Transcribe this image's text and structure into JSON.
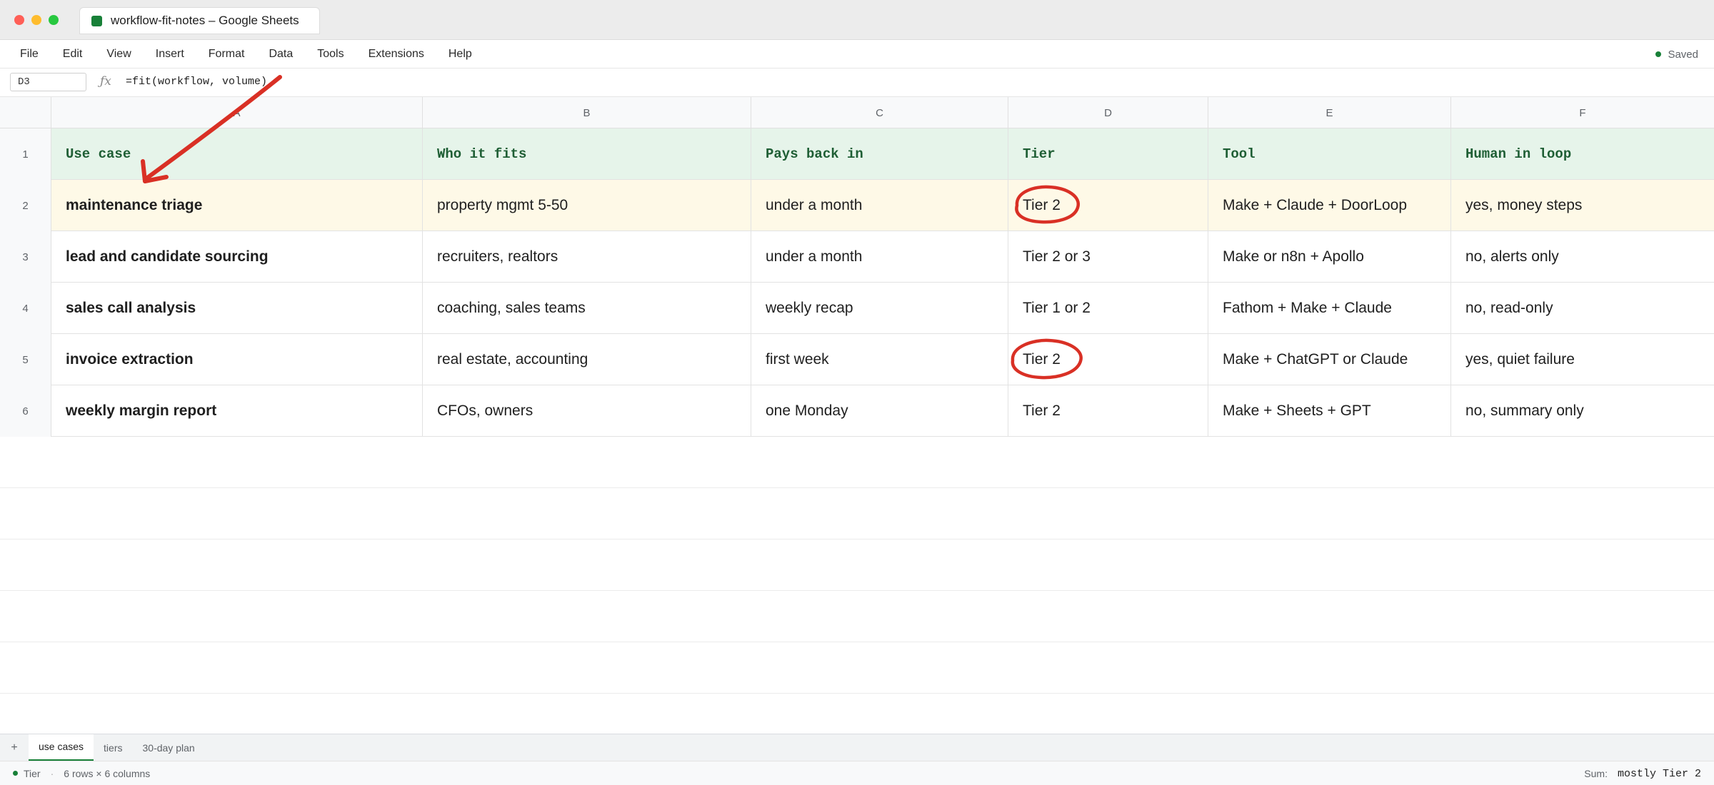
{
  "window": {
    "title": "workflow-fit-notes – Google Sheets"
  },
  "menu": [
    "File",
    "Edit",
    "View",
    "Insert",
    "Format",
    "Data",
    "Tools",
    "Extensions",
    "Help"
  ],
  "save_status": "Saved",
  "formula_bar": {
    "cell_ref": "D3",
    "fx": "ƒx",
    "formula": "=fit(workflow, volume)"
  },
  "columns": [
    "A",
    "B",
    "C",
    "D",
    "E",
    "F"
  ],
  "table": {
    "headers": [
      "Use case",
      "Who it fits",
      "Pays back in",
      "Tier",
      "Tool",
      "Human in loop"
    ],
    "rows": [
      [
        "maintenance triage",
        "property mgmt 5-50",
        "under a month",
        "Tier 2",
        "Make + Claude + DoorLoop",
        "yes, money steps"
      ],
      [
        "lead and candidate sourcing",
        "recruiters, realtors",
        "under a month",
        "Tier 2 or 3",
        "Make or n8n + Apollo",
        "no, alerts only"
      ],
      [
        "sales call analysis",
        "coaching, sales teams",
        "weekly recap",
        "Tier 1 or 2",
        "Fathom + Make + Claude",
        "no, read-only"
      ],
      [
        "invoice extraction",
        "real estate, accounting",
        "first week",
        "Tier 2",
        "Make + ChatGPT or Claude",
        "yes, quiet failure"
      ],
      [
        "weekly margin report",
        "CFOs, owners",
        "one Monday",
        "Tier 2",
        "Make + Sheets + GPT",
        "no, summary only"
      ]
    ]
  },
  "row_numbers": [
    "1",
    "2",
    "3",
    "4",
    "5",
    "6"
  ],
  "sheet_tabs": {
    "add": "+",
    "tabs": [
      "use cases",
      "tiers",
      "30-day plan"
    ]
  },
  "status": {
    "label": "Tier",
    "separator": "·",
    "dims": "6 rows × 6 columns",
    "sum_label": "Sum:",
    "sum_value": "mostly Tier 2"
  },
  "colors": {
    "header_bg": "#e6f4ea",
    "header_text": "#1e5e34",
    "selected_row": "#fef9e7",
    "annotation": "#d93025",
    "accent": "#188038"
  }
}
